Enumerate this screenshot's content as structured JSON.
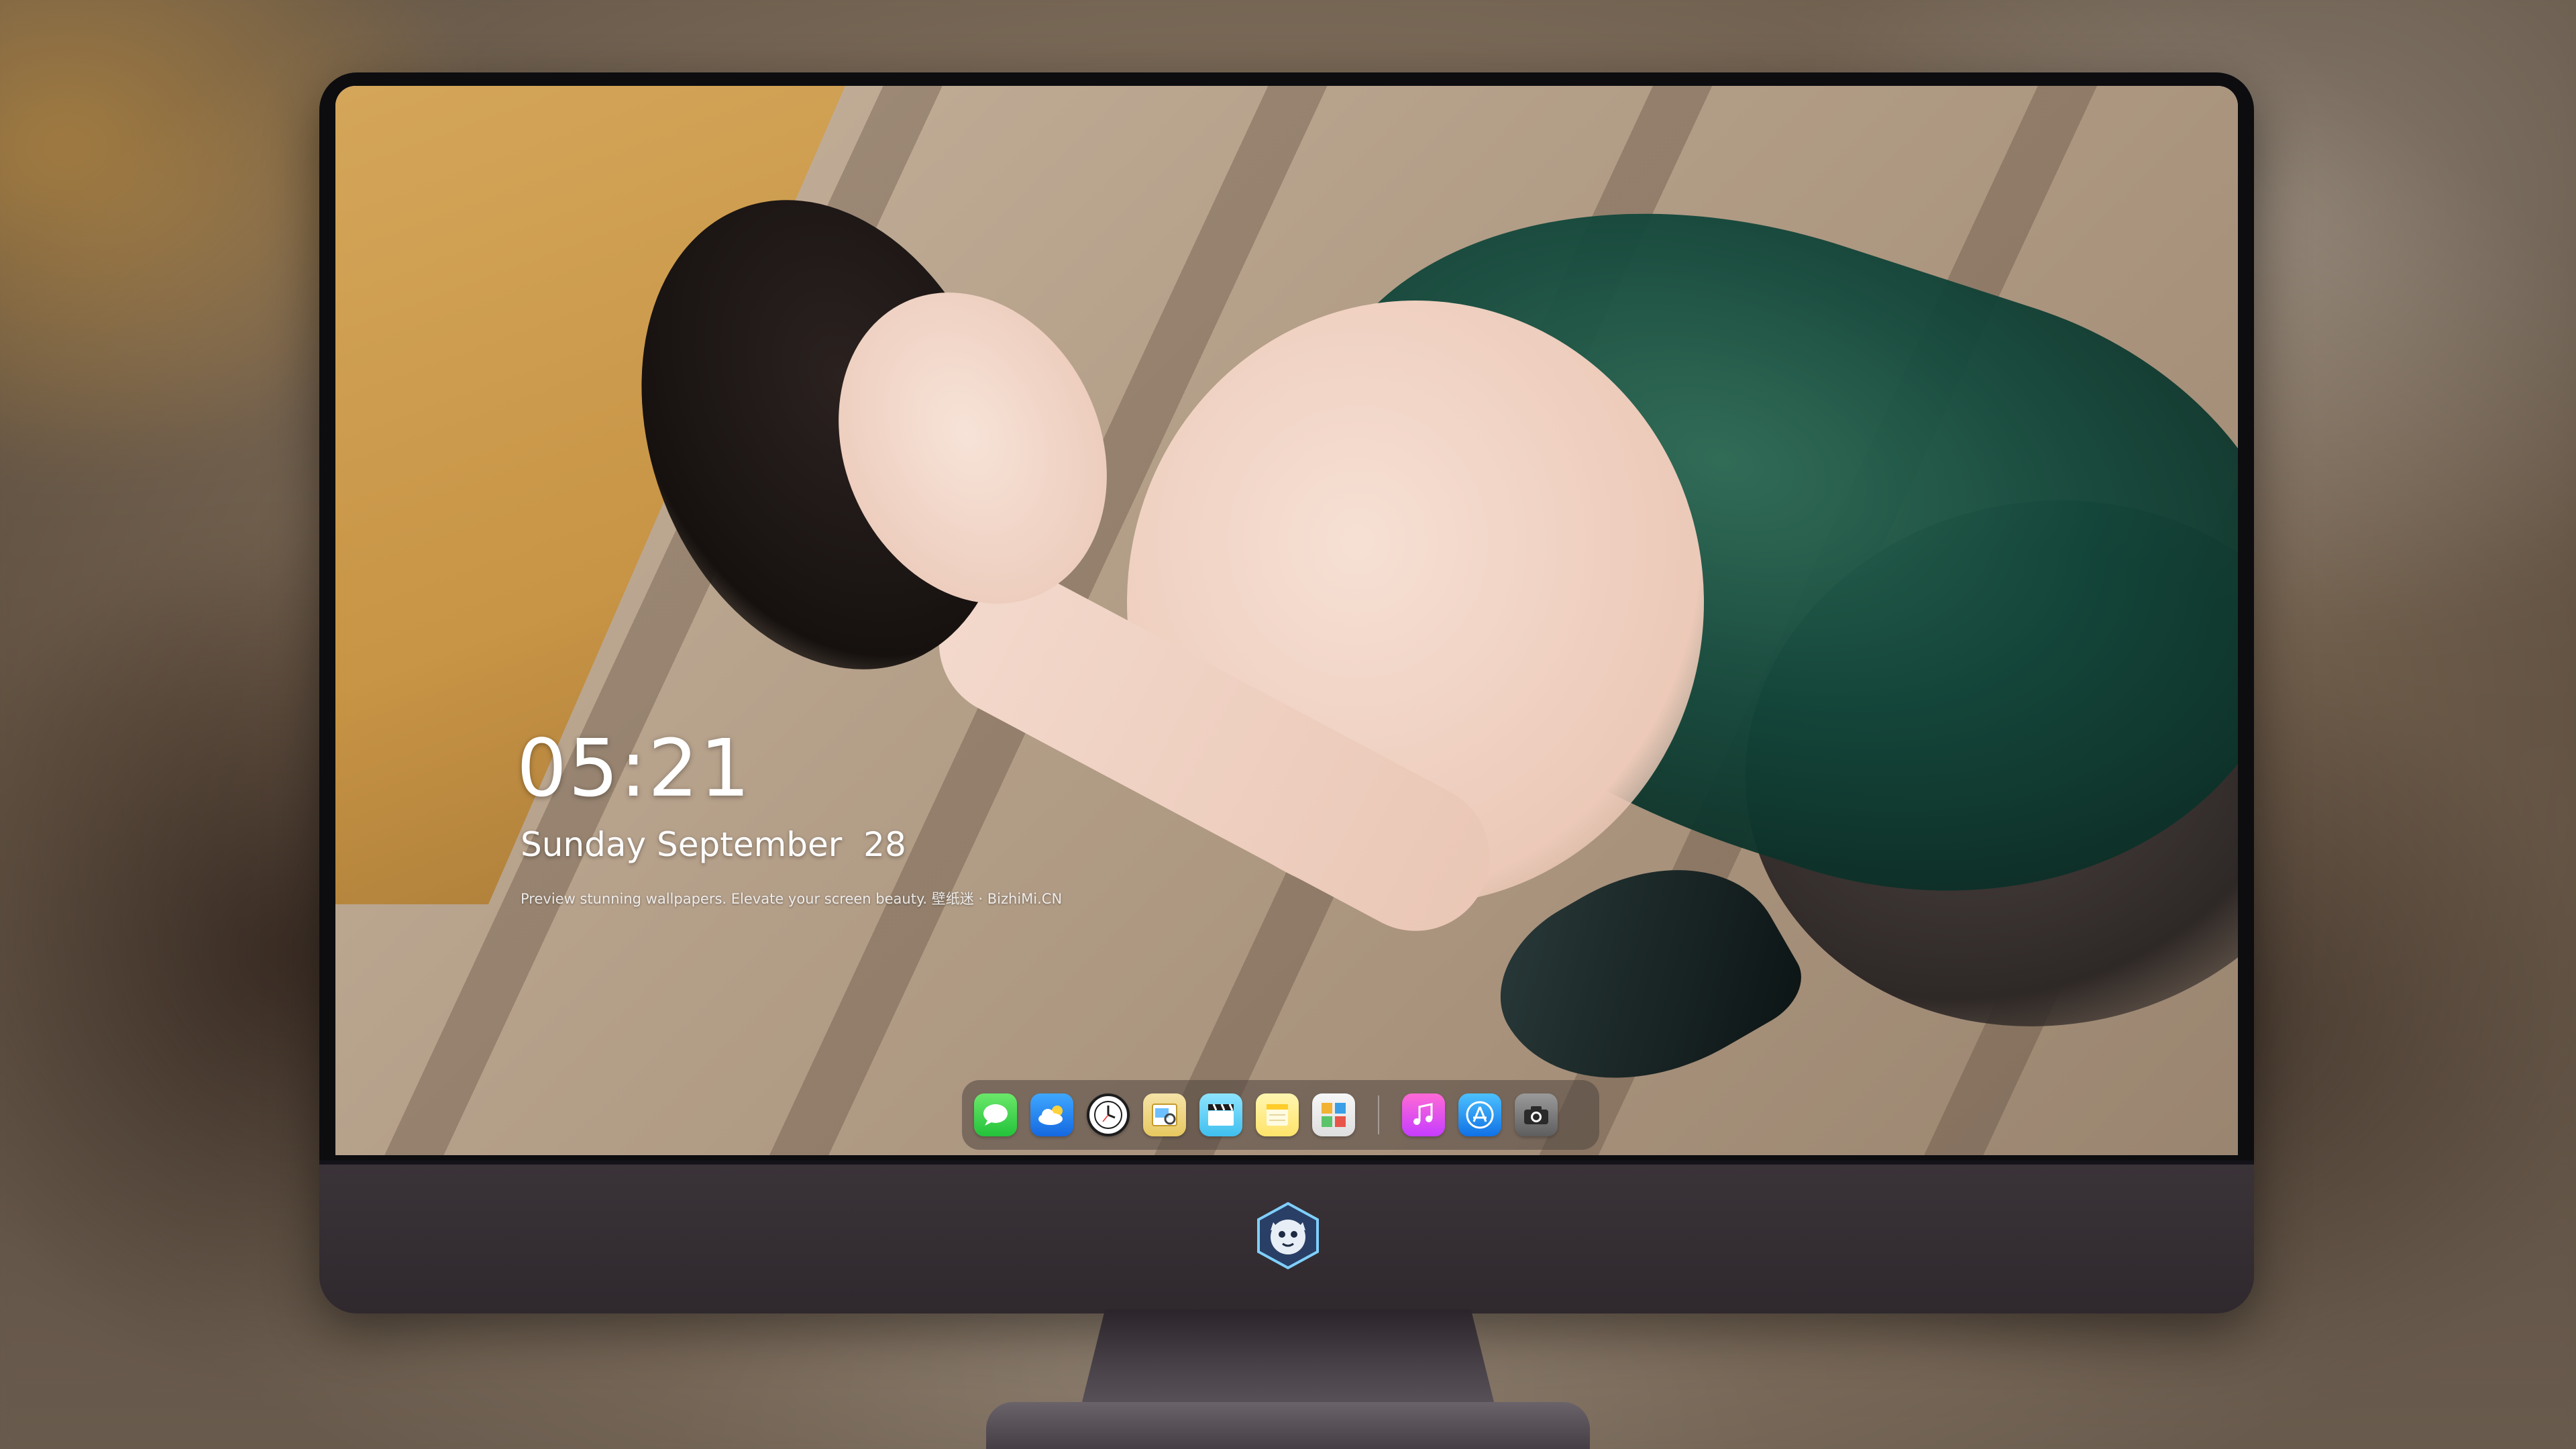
{
  "lock_screen": {
    "time": "05:21",
    "date": "Sunday September  28",
    "tagline": "Preview stunning wallpapers. Elevate your screen beauty. 壁纸迷 · BizhiMi.CN"
  },
  "dock": {
    "apps": [
      {
        "name": "Messages",
        "icon": "messages-icon"
      },
      {
        "name": "Weather",
        "icon": "weather-icon"
      },
      {
        "name": "Clock",
        "icon": "clock-icon"
      },
      {
        "name": "Preview",
        "icon": "preview-icon"
      },
      {
        "name": "Movies",
        "icon": "clapperboard-icon"
      },
      {
        "name": "Notes",
        "icon": "notes-icon"
      },
      {
        "name": "Photos",
        "icon": "photos-icon"
      },
      {
        "name": "Music",
        "icon": "music-note-icon"
      },
      {
        "name": "App Store",
        "icon": "app-store-icon"
      },
      {
        "name": "Camera",
        "icon": "camera-icon"
      }
    ]
  },
  "monitor": {
    "logo": "tiger-mascot-logo"
  },
  "colors": {
    "dock_bg": "#50463f",
    "chin": "#342d33",
    "bezel": "#0d0d10"
  }
}
